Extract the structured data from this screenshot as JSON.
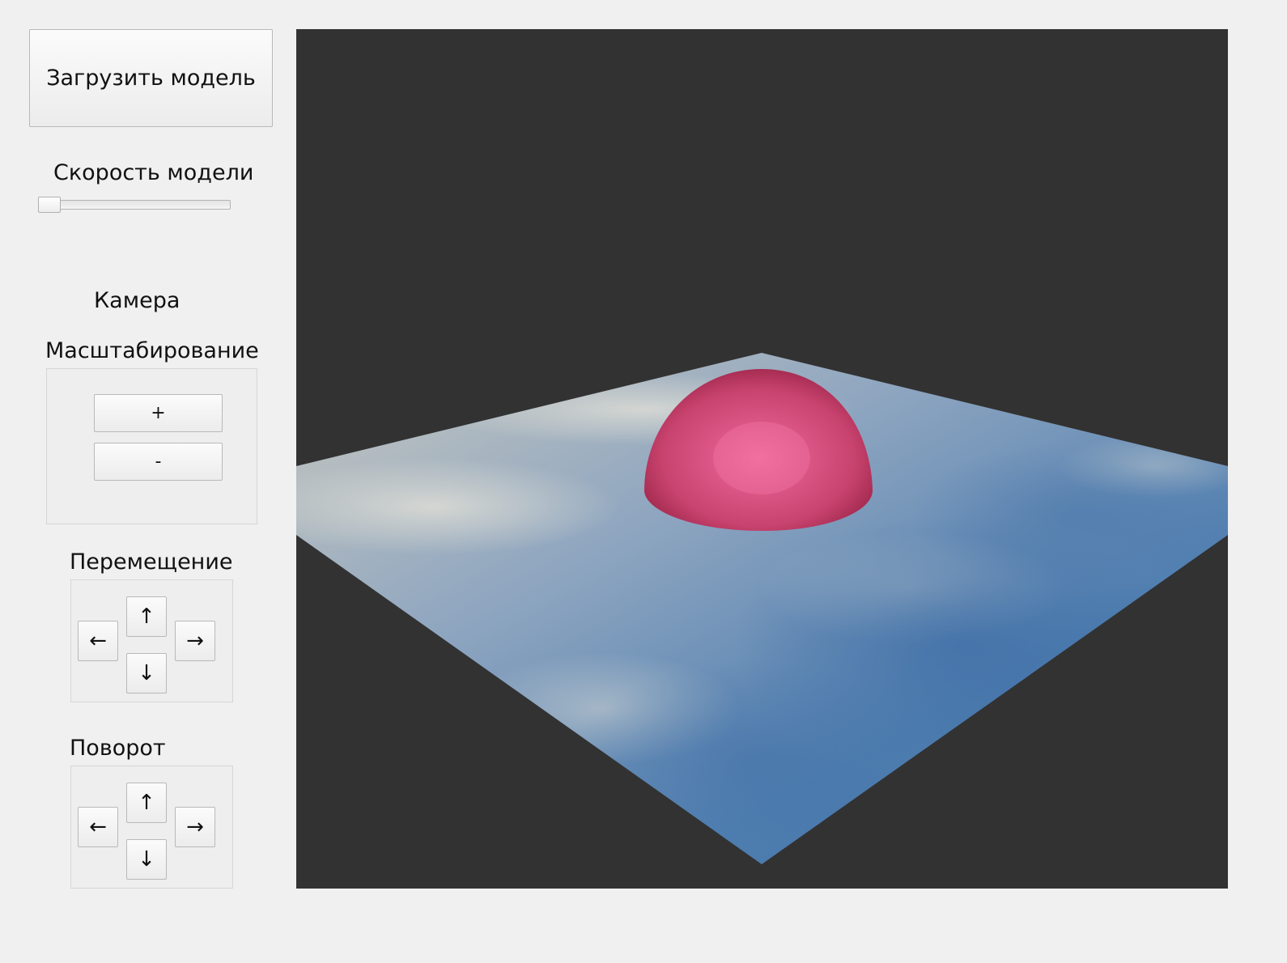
{
  "load_button": {
    "label": "Загрузить модель"
  },
  "speed": {
    "label": "Скорость модели",
    "value": 0.05
  },
  "camera": {
    "label": "Камера"
  },
  "zoom": {
    "label": "Масштабирование",
    "plus": "+",
    "minus": "-"
  },
  "move": {
    "label": "Перемещение",
    "up": "↑",
    "down": "↓",
    "left": "←",
    "right": "→"
  },
  "rotate": {
    "label": "Поворот",
    "up": "↑",
    "down": "↓",
    "left": "←",
    "right": "→"
  },
  "scene": {
    "background": "#323232",
    "plane_colors": [
      "#c8c8c0",
      "#8fa6c0",
      "#4f7eb0",
      "#3f6ea5"
    ],
    "dome_colors": [
      "#f06a9c",
      "#c8436f",
      "#9a2447"
    ]
  }
}
